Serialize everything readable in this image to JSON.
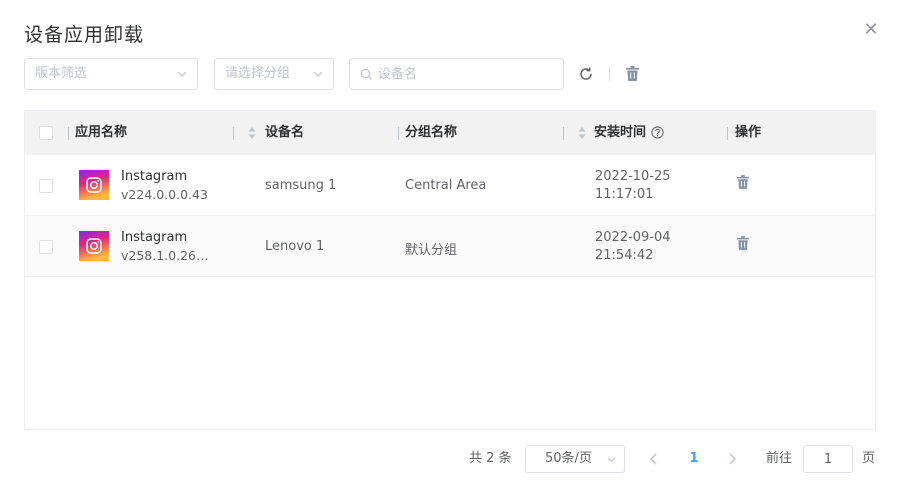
{
  "dialog": {
    "title": "设备应用卸载"
  },
  "filters": {
    "version_placeholder": "版本筛选",
    "group_placeholder": "请选择分组",
    "search_placeholder": "设备名"
  },
  "table": {
    "columns": {
      "app_name": "应用名称",
      "device_name": "设备名",
      "group_name": "分组名称",
      "install_time": "安装时间",
      "actions": "操作"
    },
    "rows": [
      {
        "app": "Instagram",
        "version": "v224.0.0.0.43",
        "device": "samsung 1",
        "group": "Central Area",
        "date": "2022-10-25",
        "time": "11:17:01"
      },
      {
        "app": "Instagram",
        "version": "v258.1.0.26.1...",
        "device": "Lenovo 1",
        "group": "默认分组",
        "date": "2022-09-04",
        "time": "21:54:42"
      }
    ]
  },
  "pagination": {
    "total": "共 2 条",
    "page_size": "50条/页",
    "current_page": "1",
    "goto_label": "前往",
    "goto_value": "1",
    "page_unit": "页"
  },
  "colors": {
    "accent": "#409eff",
    "icon_gray": "#8492a6"
  }
}
